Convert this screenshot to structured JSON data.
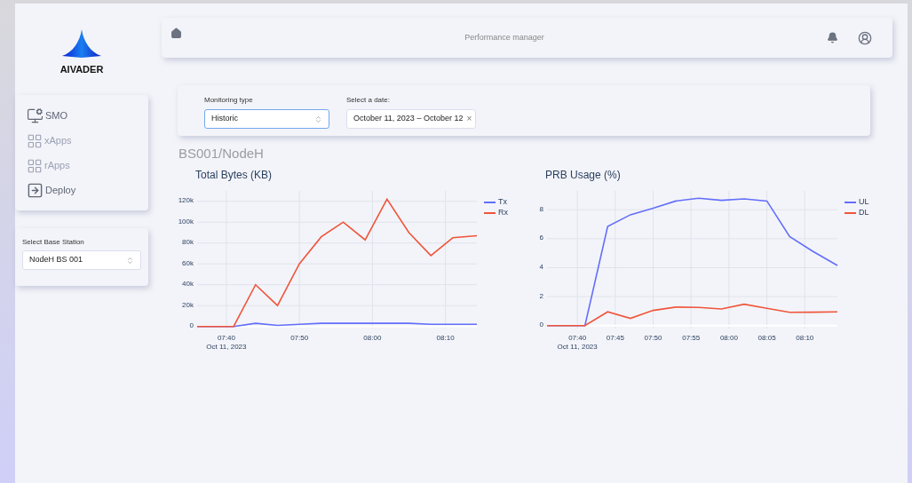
{
  "brand": {
    "name": "AIVADER"
  },
  "sidebar": {
    "items": [
      {
        "label": "SMO",
        "disabled": false
      },
      {
        "label": "xApps",
        "disabled": true
      },
      {
        "label": "rApps",
        "disabled": true
      },
      {
        "label": "Deploy",
        "disabled": false
      }
    ]
  },
  "base_station": {
    "label": "Select Base Station",
    "value": "NodeH BS 001"
  },
  "header": {
    "title": "Performance manager"
  },
  "filters": {
    "monitoring_type": {
      "label": "Monitoring type",
      "value": "Historic"
    },
    "date": {
      "label": "Select a date:",
      "value": "October 11, 2023 – October 12",
      "clear": "×"
    }
  },
  "page_title": "BS001/NodeH",
  "charts": [
    {
      "chart_data": {
        "type": "line",
        "title": "Total Bytes (KB)",
        "x": [
          456,
          461,
          464,
          467,
          470,
          473,
          476,
          479,
          482,
          485,
          488,
          491,
          494.3
        ],
        "series": [
          {
            "name": "Tx",
            "color": "#636efa",
            "values": [
              0,
              0,
              3000,
              1000,
              2000,
              3000,
              3000,
              3000,
              3000,
              3000,
              2000,
              2000,
              2000
            ]
          },
          {
            "name": "Rx",
            "color": "#ef553b",
            "values": [
              0,
              0,
              40000,
              20000,
              60000,
              86000,
              100000,
              83000,
              122000,
              90000,
              68000,
              85000,
              87000
            ]
          }
        ],
        "xlim": [
          456,
          494.3
        ],
        "ylim": [
          -2000,
          130000
        ],
        "yticks": [
          {
            "value": 0,
            "label": "0"
          },
          {
            "value": 20000,
            "label": "20k"
          },
          {
            "value": 40000,
            "label": "40k"
          },
          {
            "value": 60000,
            "label": "60k"
          },
          {
            "value": 80000,
            "label": "80k"
          },
          {
            "value": 100000,
            "label": "100k"
          },
          {
            "value": 120000,
            "label": "120k"
          }
        ],
        "xticks": [
          {
            "value": 460,
            "label": "07:40\nOct 11, 2023"
          },
          {
            "value": 470,
            "label": "07:50"
          },
          {
            "value": 480,
            "label": "08:00"
          },
          {
            "value": 490,
            "label": "08:10"
          }
        ],
        "grid": true,
        "legend": true
      }
    },
    {
      "chart_data": {
        "type": "line",
        "title": "PRB Usage (%)",
        "x": [
          456,
          461,
          464,
          467,
          470,
          473,
          476,
          479,
          482,
          485,
          488,
          491,
          494.3
        ],
        "series": [
          {
            "name": "UL",
            "color": "#636efa",
            "values": [
              0,
              0,
              6.85,
              7.65,
              8.1,
              8.6,
              8.8,
              8.65,
              8.75,
              8.6,
              6.15,
              5.15,
              4.15
            ]
          },
          {
            "name": "DL",
            "color": "#ef553b",
            "values": [
              0,
              0,
              0.95,
              0.5,
              1.05,
              1.28,
              1.25,
              1.15,
              1.48,
              1.2,
              0.92,
              0.93,
              0.95
            ]
          }
        ],
        "xlim": [
          456,
          494.3
        ],
        "ylim": [
          -0.2,
          9.3
        ],
        "yticks": [
          0,
          2,
          4,
          6,
          8
        ],
        "xticks": [
          {
            "value": 460,
            "label": "07:40\nOct 11, 2023"
          },
          {
            "value": 465,
            "label": "07:45"
          },
          {
            "value": 470,
            "label": "07:50"
          },
          {
            "value": 475,
            "label": "07:55"
          },
          {
            "value": 480,
            "label": "08:00"
          },
          {
            "value": 485,
            "label": "08:05"
          },
          {
            "value": 490,
            "label": "08:10"
          }
        ],
        "grid": true,
        "legend": true
      }
    }
  ]
}
